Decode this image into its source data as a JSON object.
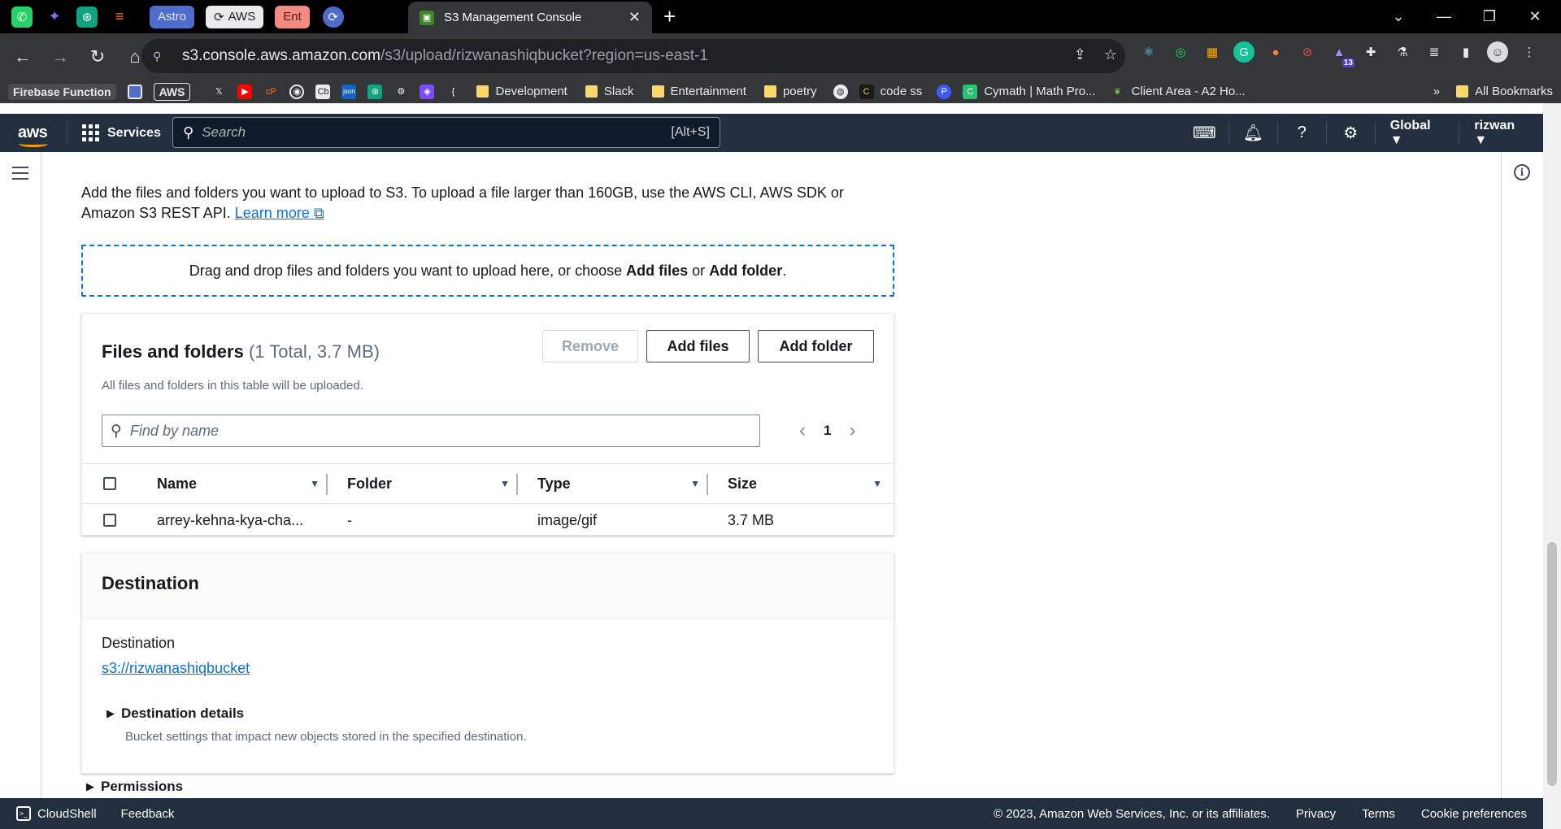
{
  "browser": {
    "pinned_tabs": [
      {
        "name": "whatsapp-icon",
        "glyph": "✆",
        "color": "#25d366"
      },
      {
        "name": "gemini-icon",
        "glyph": "✦",
        "color": "#8a6cff"
      },
      {
        "name": "chatgpt-icon",
        "glyph": "⊛",
        "color": "#10a37f"
      },
      {
        "name": "stackoverflow-icon",
        "glyph": "≡",
        "color": "#f48024"
      }
    ],
    "group_tabs": [
      {
        "label": "Astro",
        "bg": "#4d6ccc",
        "fg": "#e8eaed"
      },
      {
        "label": "AWS",
        "bg": "#e8eaed",
        "fg": "#202124"
      },
      {
        "label": "Ent",
        "bg": "#f28b82",
        "fg": "#5b1a16"
      }
    ],
    "active_tab": {
      "title": "S3 Management Console"
    },
    "url": {
      "host": "s3.console.aws.amazon.com",
      "path": "/s3/upload/rizwanashiqbucket?region=us-east-1"
    },
    "extension_badge": "13",
    "bookmarks": [
      {
        "label": "Firebase Function",
        "type": "chip"
      },
      {
        "label": "AWS",
        "type": "chip"
      },
      {
        "label": "Development",
        "type": "folder"
      },
      {
        "label": "Slack",
        "type": "folder"
      },
      {
        "label": "Entertainment",
        "type": "folder"
      },
      {
        "label": "poetry",
        "type": "folder"
      },
      {
        "label": "code ss",
        "type": "site"
      },
      {
        "label": "Cymath | Math Pro...",
        "type": "site"
      },
      {
        "label": "Client Area - A2 Ho...",
        "type": "site"
      }
    ],
    "bookmarks_overflow": "»",
    "all_bookmarks": "All Bookmarks"
  },
  "aws_nav": {
    "logo": "aws",
    "services": "Services",
    "search_placeholder": "Search",
    "search_shortcut": "[Alt+S]",
    "region": "Global ▼",
    "user": "rizwan ▼"
  },
  "upload": {
    "intro": "Add the files and folders you want to upload to S3. To upload a file larger than 160GB, use the AWS CLI, AWS SDK or Amazon S3 REST API.",
    "learn_more": "Learn more",
    "dropzone_text": "Drag and drop files and folders you want to upload here, or choose",
    "dropzone_add_files": "Add files",
    "dropzone_or": "or",
    "dropzone_add_folder": "Add folder",
    "dropzone_end": "."
  },
  "files_panel": {
    "title": "Files and folders",
    "count": "(1 Total, 3.7 MB)",
    "description": "All files and folders in this table will be uploaded.",
    "buttons": {
      "remove": "Remove",
      "add_files": "Add files",
      "add_folder": "Add folder"
    },
    "filter_placeholder": "Find by name",
    "page": "1",
    "columns": [
      "Name",
      "Folder",
      "Type",
      "Size"
    ],
    "rows": [
      {
        "name": "arrey-kehna-kya-cha...",
        "folder": "-",
        "type": "image/gif",
        "size": "3.7 MB"
      }
    ]
  },
  "destination": {
    "title": "Destination",
    "label": "Destination",
    "uri": "s3://rizwanashiqbucket",
    "details_title": "Destination details",
    "details_desc": "Bucket settings that impact new objects stored in the specified destination."
  },
  "permissions": {
    "title": "Permissions"
  },
  "footer": {
    "cloudshell": "CloudShell",
    "feedback": "Feedback",
    "copyright": "© 2023, Amazon Web Services, Inc. or its affiliates.",
    "privacy": "Privacy",
    "terms": "Terms",
    "cookies": "Cookie preferences"
  }
}
